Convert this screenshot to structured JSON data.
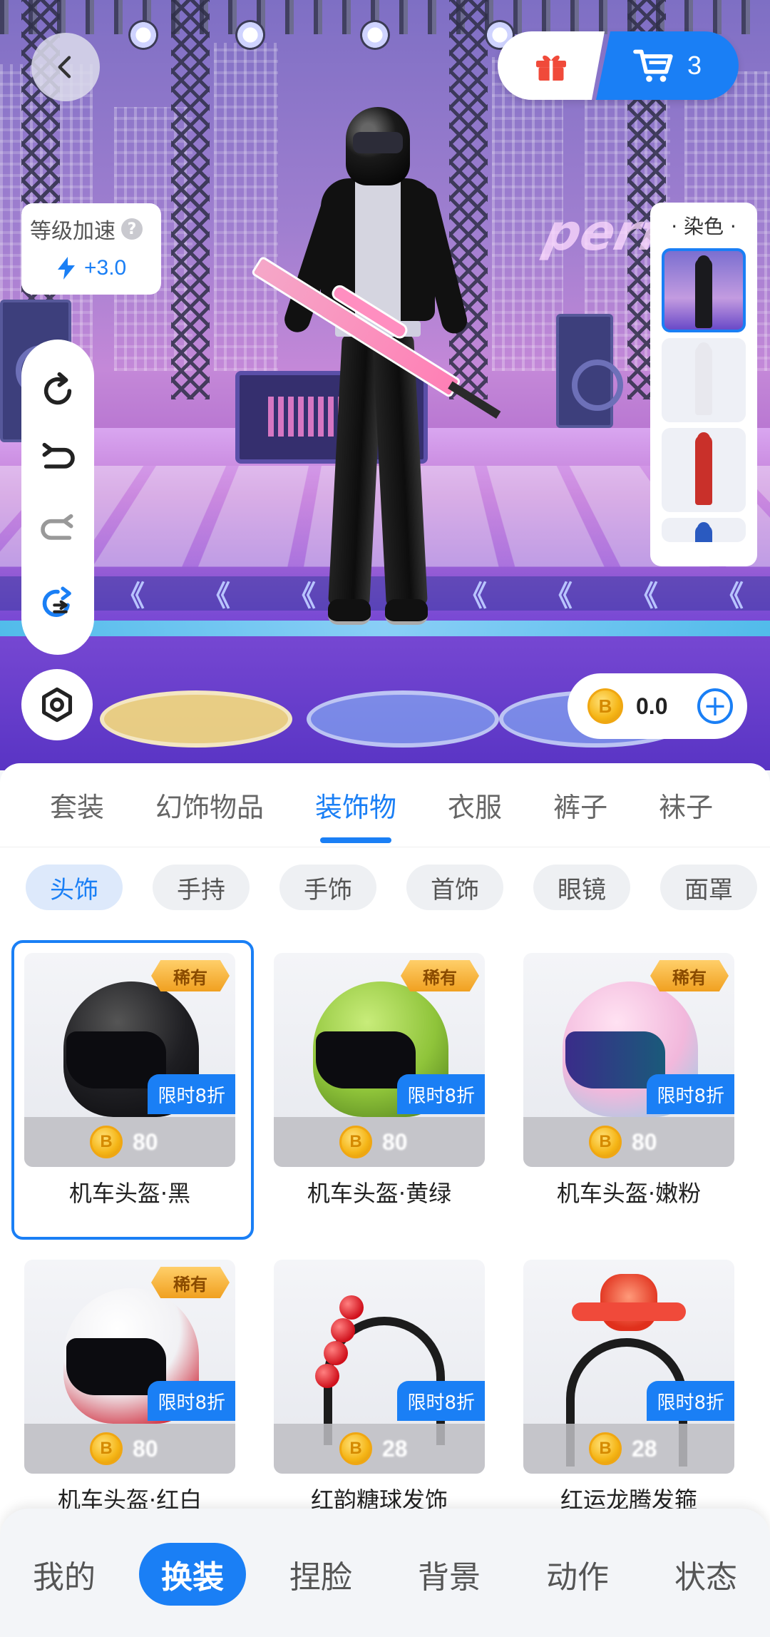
{
  "header": {
    "back_icon": "chevron-left-icon",
    "gift_icon": "gift-icon",
    "cart_icon": "cart-icon",
    "cart_count": "3"
  },
  "level_speed": {
    "title": "等级加速",
    "help_icon": "question-icon",
    "help_glyph": "?",
    "boost_icon": "lightning-icon",
    "value": "+3.0"
  },
  "tools": [
    "rotate-icon",
    "undo-icon",
    "redo-icon",
    "share-icon"
  ],
  "settings_icon": "hexagon-settings-icon",
  "dye_panel": {
    "title": "· 染色 ·"
  },
  "scene": {
    "sign_text": "perf"
  },
  "wallet": {
    "coin_glyph": "B",
    "balance": "0.0",
    "add_glyph": "+"
  },
  "category_tabs": [
    {
      "label": "套装",
      "active": false
    },
    {
      "label": "幻饰物品",
      "active": false
    },
    {
      "label": "装饰物",
      "active": true
    },
    {
      "label": "衣服",
      "active": false
    },
    {
      "label": "裤子",
      "active": false
    },
    {
      "label": "袜子",
      "active": false
    }
  ],
  "sub_tabs": [
    {
      "label": "头饰",
      "active": true
    },
    {
      "label": "手持",
      "active": false
    },
    {
      "label": "手饰",
      "active": false
    },
    {
      "label": "首饰",
      "active": false
    },
    {
      "label": "眼镜",
      "active": false
    },
    {
      "label": "面罩",
      "active": false
    }
  ],
  "items": [
    {
      "name": "机车头盔·黑",
      "rare": "稀有",
      "sale": "限时8折",
      "price": "80",
      "selected": true,
      "color": "#1e1e22"
    },
    {
      "name": "机车头盔·黄绿",
      "rare": "稀有",
      "sale": "限时8折",
      "price": "80",
      "selected": false,
      "color": "#8fc43a"
    },
    {
      "name": "机车头盔·嫩粉",
      "rare": "稀有",
      "sale": "限时8折",
      "price": "80",
      "selected": false,
      "color": "#f2b8dc"
    },
    {
      "name": "机车头盔·红白",
      "rare": "稀有",
      "sale": "限时8折",
      "price": "80",
      "selected": false,
      "color": "#f1f1f4"
    },
    {
      "name": "红韵糖球发饰",
      "rare": "",
      "sale": "限时8折",
      "price": "28",
      "selected": false,
      "color": "#d0101b"
    },
    {
      "name": "红运龙腾发箍",
      "rare": "",
      "sale": "限时8折",
      "price": "28",
      "selected": false,
      "color": "#e0301c"
    }
  ],
  "bottom_nav": [
    {
      "label": "我的",
      "active": false
    },
    {
      "label": "换装",
      "active": true
    },
    {
      "label": "捏脸",
      "active": false
    },
    {
      "label": "背景",
      "active": false
    },
    {
      "label": "动作",
      "active": false
    },
    {
      "label": "状态",
      "active": false
    }
  ],
  "colors": {
    "accent": "#1a7ff5",
    "rare_badge": "#f0a020",
    "coin": "#f5b516"
  }
}
